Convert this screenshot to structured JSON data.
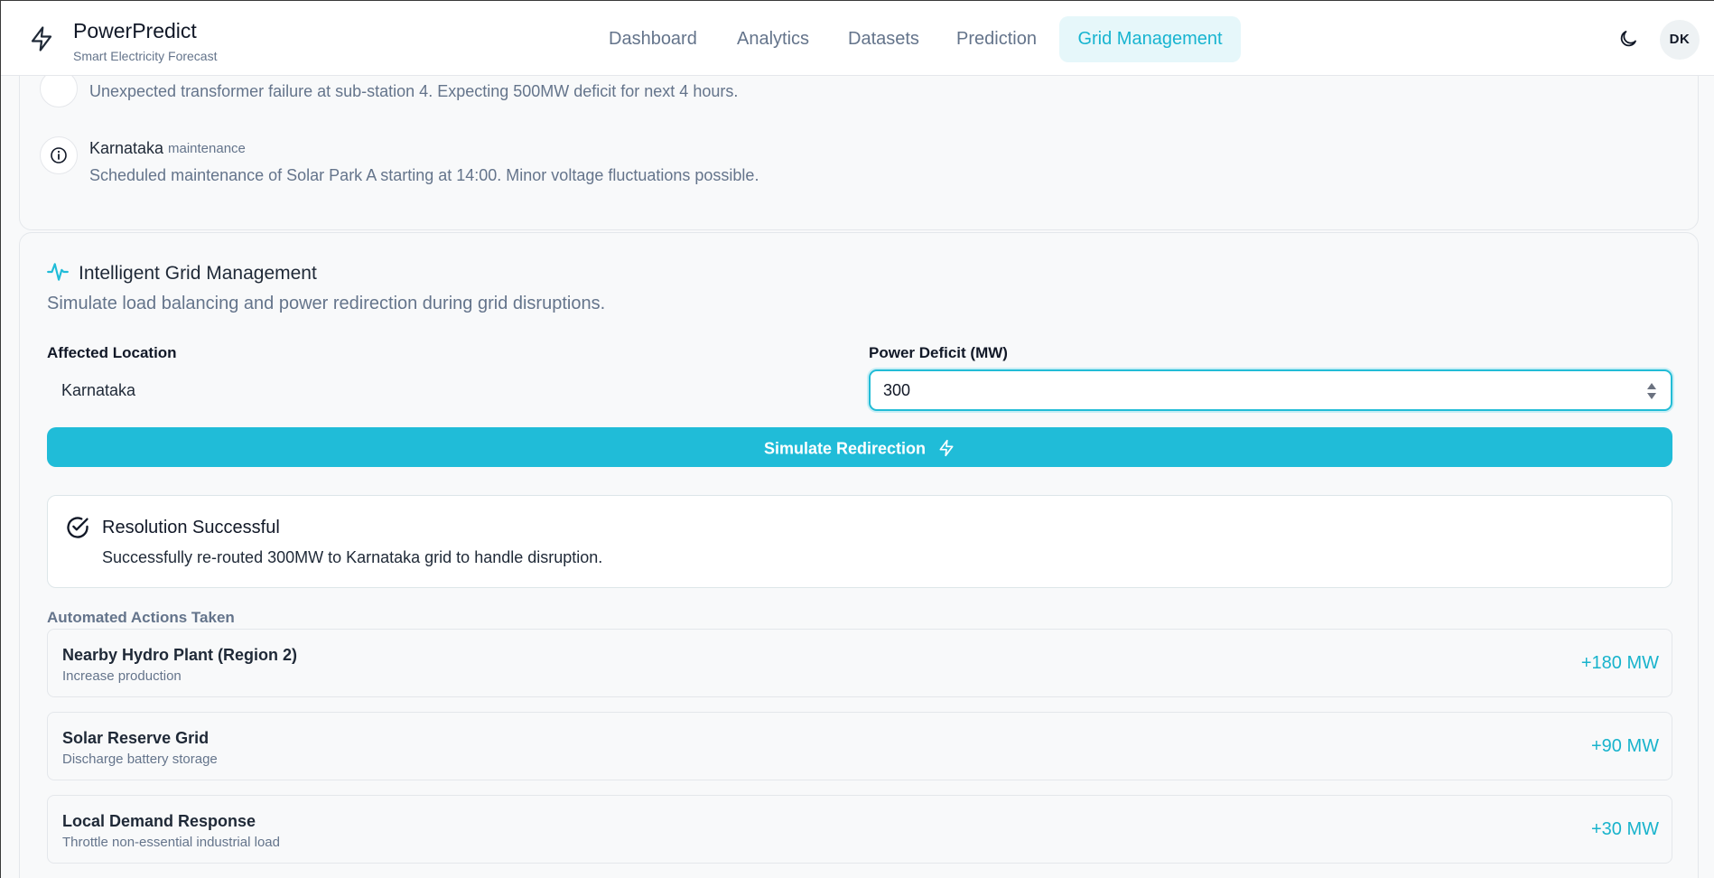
{
  "header": {
    "brand_title": "PowerPredict",
    "brand_subtitle": "Smart Electricity Forecast",
    "nav": [
      "Dashboard",
      "Analytics",
      "Datasets",
      "Prediction",
      "Grid Management"
    ],
    "active_nav": "Grid Management",
    "avatar_initials": "DK",
    "theme_icon": "moon-icon",
    "brand_icon": "lightning-icon"
  },
  "alerts": {
    "partial_alert_text": "Unexpected transformer failure at sub-station 4. Expecting 500MW deficit for next 4 hours.",
    "maintenance": {
      "region": "Karnataka",
      "tag": "maintenance",
      "text": "Scheduled maintenance of Solar Park A starting at 14:00. Minor voltage fluctuations possible.",
      "icon": "info-icon"
    }
  },
  "grid": {
    "title": "Intelligent Grid Management",
    "title_icon": "activity-pulse-icon",
    "description": "Simulate load balancing and power redirection during grid disruptions.",
    "location_label": "Affected Location",
    "location_value": "Karnataka",
    "deficit_label": "Power Deficit (MW)",
    "deficit_value": "300",
    "simulate_label": "Simulate Redirection",
    "result": {
      "title": "Resolution Successful",
      "description": "Successfully re-routed 300MW to Karnataka grid to handle disruption.",
      "icon": "check-circle-icon"
    },
    "actions_heading": "Automated Actions Taken",
    "actions": [
      {
        "title": "Nearby Hydro Plant (Region 2)",
        "subtitle": "Increase production",
        "amount": "+180 MW"
      },
      {
        "title": "Solar Reserve Grid",
        "subtitle": "Discharge battery storage",
        "amount": "+90 MW"
      },
      {
        "title": "Local Demand Response",
        "subtitle": "Throttle non-essential industrial load",
        "amount": "+30 MW"
      }
    ]
  },
  "colors": {
    "accent": "#20bcd8",
    "accent_text": "#17b4d0",
    "muted_text": "#64748b"
  }
}
